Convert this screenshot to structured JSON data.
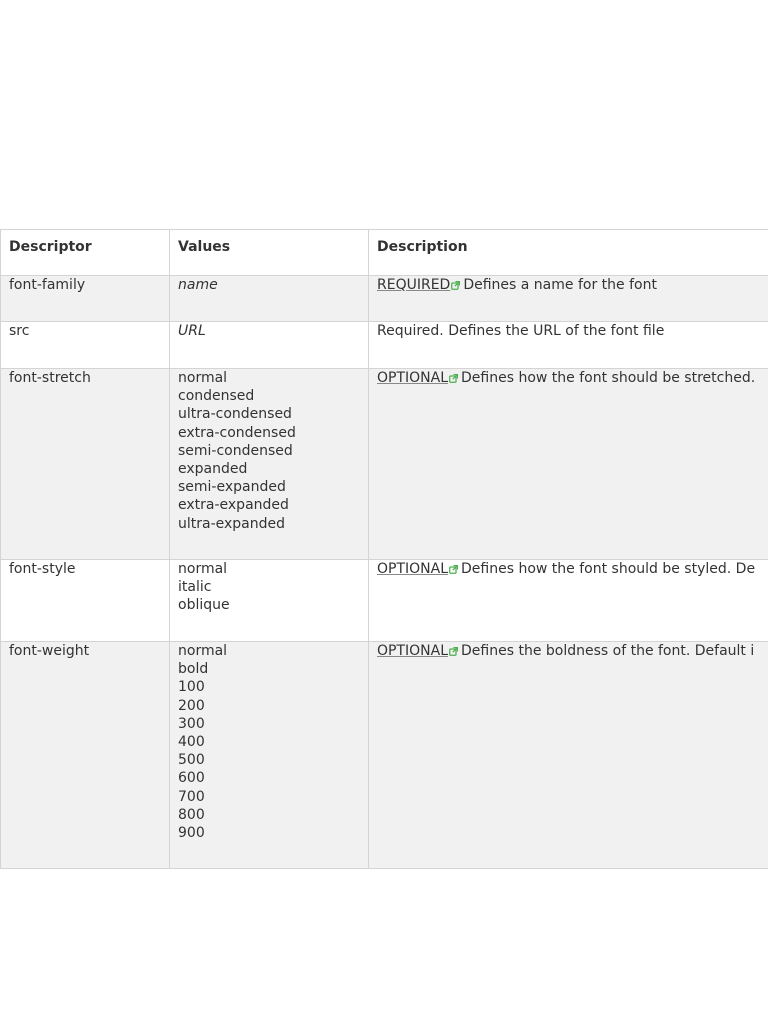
{
  "table": {
    "headers": [
      "Descriptor",
      "Values",
      "Description"
    ],
    "rows": [
      {
        "descriptor": "font-family",
        "values": [
          "name"
        ],
        "values_italic": true,
        "link": "REQUIRED",
        "description": "Defines a name for the font"
      },
      {
        "descriptor": "src",
        "values": [
          "URL"
        ],
        "values_italic": true,
        "link": "",
        "description": "Required. Defines the URL of the font file"
      },
      {
        "descriptor": "font-stretch",
        "values": [
          "normal",
          "condensed",
          "ultra-condensed",
          "extra-condensed",
          "semi-condensed",
          "expanded",
          "semi-expanded",
          "extra-expanded",
          "ultra-expanded"
        ],
        "values_italic": false,
        "link": "OPTIONAL",
        "description": "Defines how the font should be stretched."
      },
      {
        "descriptor": "font-style",
        "values": [
          "normal",
          "italic",
          "oblique"
        ],
        "values_italic": false,
        "link": "OPTIONAL",
        "description": "Defines how the font should be styled. De"
      },
      {
        "descriptor": "font-weight",
        "values": [
          "normal",
          "bold",
          "100",
          "200",
          "300",
          "400",
          "500",
          "600",
          "700",
          "800",
          "900"
        ],
        "values_italic": false,
        "link": "OPTIONAL",
        "description": "Defines the boldness of the font. Default i"
      }
    ]
  },
  "icons": {
    "external_link": "external-link-icon"
  },
  "colors": {
    "shade_row": "#f1f1f1",
    "border": "#d4d4d4",
    "text": "#333333",
    "link_icon": "#4caf50"
  }
}
